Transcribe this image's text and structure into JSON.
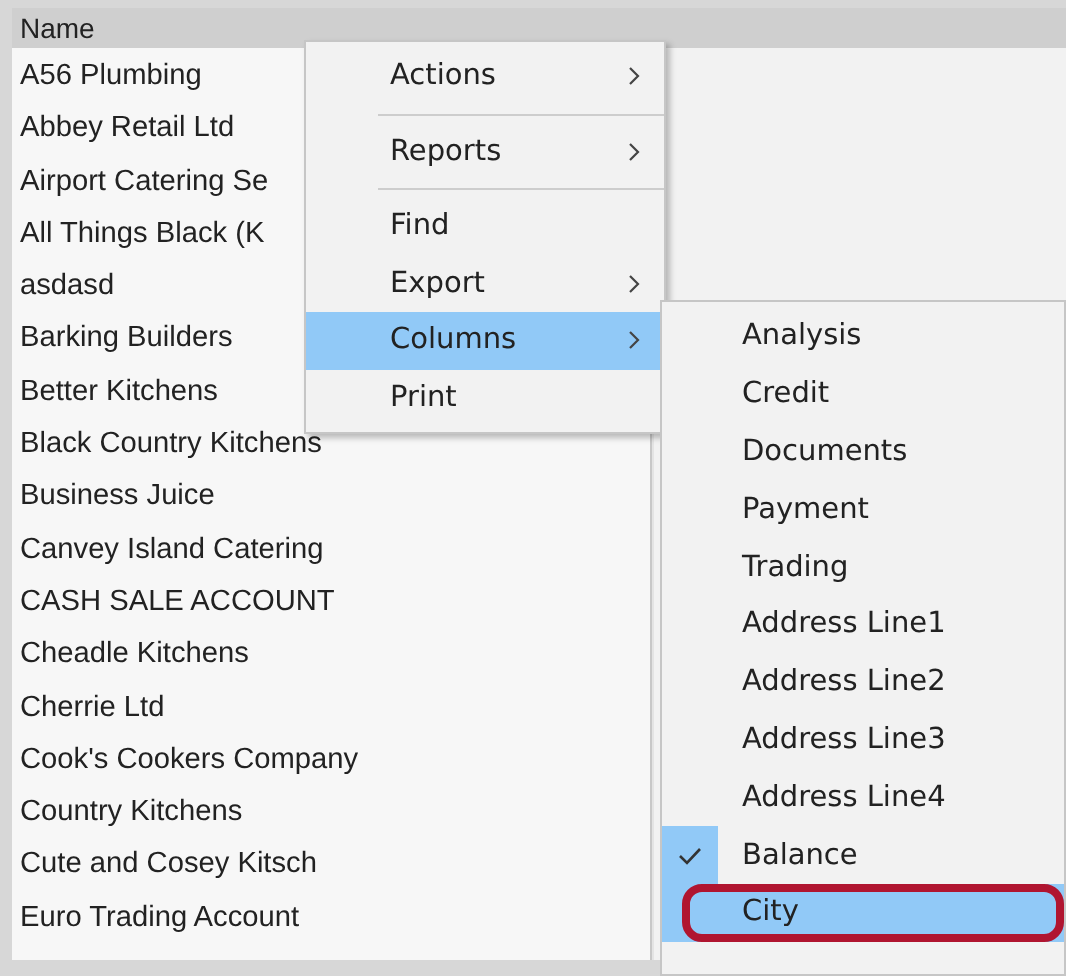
{
  "list": {
    "columns": [
      {
        "label": "Name"
      }
    ],
    "rows": [
      "A56 Plumbing",
      "Abbey Retail Ltd",
      "Airport Catering Se",
      "All Things Black (K",
      "asdasd",
      "Barking Builders",
      "Better Kitchens",
      "Black Country Kitchens",
      "Business Juice",
      "Canvey Island Catering",
      "CASH SALE ACCOUNT",
      "Cheadle Kitchens",
      "Cherrie Ltd",
      "Cook's Cookers Company",
      "Country Kitchens",
      "Cute and Cosey Kitsch",
      "Euro Trading Account"
    ]
  },
  "context_menu": {
    "items": [
      {
        "label": "Actions",
        "submenu": true,
        "selected": false,
        "separator_after": true
      },
      {
        "label": "Reports",
        "submenu": true,
        "selected": false,
        "separator_after": true
      },
      {
        "label": "Find",
        "submenu": false,
        "selected": false,
        "separator_after": false
      },
      {
        "label": "Export",
        "submenu": true,
        "selected": false,
        "separator_after": false
      },
      {
        "label": "Columns",
        "submenu": true,
        "selected": true,
        "separator_after": false
      },
      {
        "label": "Print",
        "submenu": false,
        "selected": false,
        "separator_after": false
      }
    ]
  },
  "columns_submenu": {
    "items": [
      {
        "label": "Analysis",
        "checked": false,
        "selected": false,
        "callout": false
      },
      {
        "label": "Credit",
        "checked": false,
        "selected": false,
        "callout": false
      },
      {
        "label": "Documents",
        "checked": false,
        "selected": false,
        "callout": false
      },
      {
        "label": "Payment",
        "checked": false,
        "selected": false,
        "callout": false
      },
      {
        "label": "Trading",
        "checked": false,
        "selected": false,
        "callout": false
      },
      {
        "label": "Address Line1",
        "checked": false,
        "selected": false,
        "callout": false
      },
      {
        "label": "Address Line2",
        "checked": false,
        "selected": false,
        "callout": false
      },
      {
        "label": "Address Line3",
        "checked": false,
        "selected": false,
        "callout": false
      },
      {
        "label": "Address Line4",
        "checked": false,
        "selected": false,
        "callout": false
      },
      {
        "label": "Balance",
        "checked": true,
        "selected": false,
        "callout": false
      },
      {
        "label": "City",
        "checked": false,
        "selected": true,
        "callout": true
      }
    ]
  }
}
